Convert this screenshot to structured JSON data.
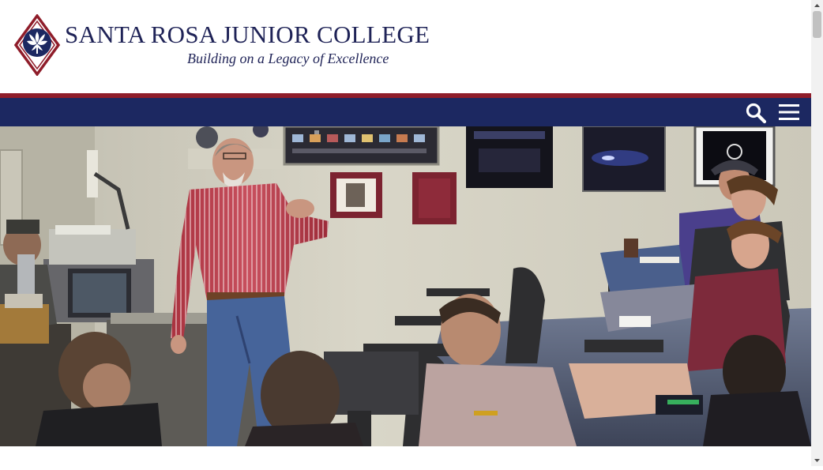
{
  "header": {
    "college_name": "SANTA ROSA JUNIOR COLLEGE",
    "tagline": "Building on a Legacy of Excellence",
    "logo_icon": "srjc-oak-leaf-seal-icon"
  },
  "nav": {
    "search_icon": "search-icon",
    "menu_icon": "hamburger-menu-icon"
  },
  "hero": {
    "image_subject": "instructor-lecturing-classroom-photo"
  },
  "colors": {
    "brand_navy": "#1c2861",
    "brand_red": "#8f1d2a",
    "text_navy": "#1f2357"
  }
}
